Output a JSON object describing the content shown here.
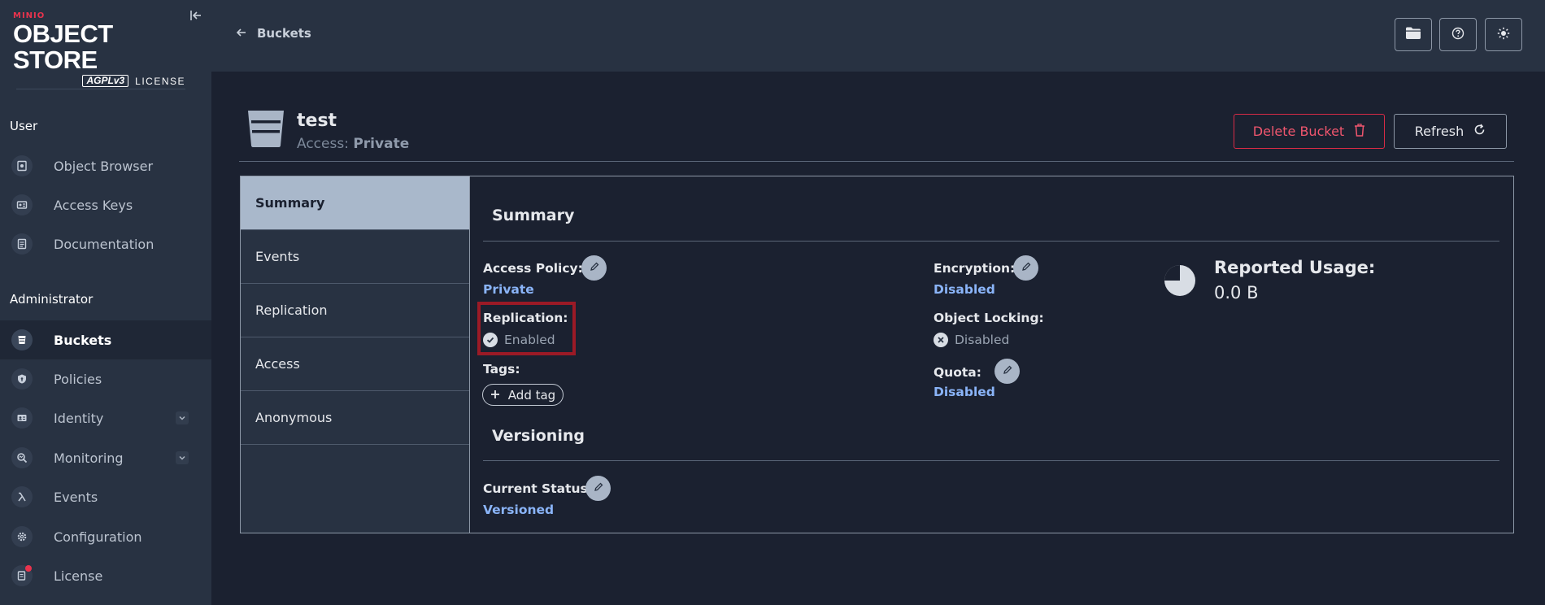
{
  "brand": {
    "vendor": "MINIO",
    "product": "OBJECT STORE",
    "license_badge": "AGPLv3",
    "license_word": "LICENSE"
  },
  "sidebar": {
    "user_section": "User",
    "user_items": [
      {
        "label": "Object Browser",
        "icon": "object-browser-icon"
      },
      {
        "label": "Access Keys",
        "icon": "access-keys-icon"
      },
      {
        "label": "Documentation",
        "icon": "documentation-icon"
      }
    ],
    "admin_section": "Administrator",
    "admin_items": [
      {
        "label": "Buckets",
        "icon": "bucket-icon",
        "active": true
      },
      {
        "label": "Policies",
        "icon": "policy-shield-icon"
      },
      {
        "label": "Identity",
        "icon": "identity-card-icon",
        "expandable": true
      },
      {
        "label": "Monitoring",
        "icon": "monitoring-magnifier-icon",
        "expandable": true
      },
      {
        "label": "Events",
        "icon": "lambda-icon"
      },
      {
        "label": "Configuration",
        "icon": "gear-icon"
      },
      {
        "label": "License",
        "icon": "license-document-icon",
        "badge_color": "#e9334d"
      }
    ]
  },
  "topbar": {
    "back_label": "Buckets",
    "buttons": [
      "folder-icon",
      "help-icon",
      "theme-sun-icon"
    ]
  },
  "bucket": {
    "name": "test",
    "access_label": "Access:",
    "access_value": "Private",
    "delete_label": "Delete Bucket",
    "refresh_label": "Refresh"
  },
  "tabs": [
    "Summary",
    "Events",
    "Replication",
    "Access",
    "Anonymous"
  ],
  "summary": {
    "title": "Summary",
    "access_policy_label": "Access Policy:",
    "access_policy_value": "Private",
    "replication_label": "Replication:",
    "replication_value": "Enabled",
    "tags_label": "Tags:",
    "add_tag_label": "Add tag",
    "encryption_label": "Encryption:",
    "encryption_value": "Disabled",
    "object_locking_label": "Object Locking:",
    "object_locking_value": "Disabled",
    "quota_label": "Quota:",
    "quota_value": "Disabled",
    "usage_label": "Reported Usage:",
    "usage_value": "0.0 B"
  },
  "versioning": {
    "title": "Versioning",
    "status_label": "Current Status:",
    "status_value": "Versioned"
  },
  "colors": {
    "accent_link": "#8ab4f8",
    "danger": "#d82b46",
    "highlight": "#9b1a26"
  }
}
